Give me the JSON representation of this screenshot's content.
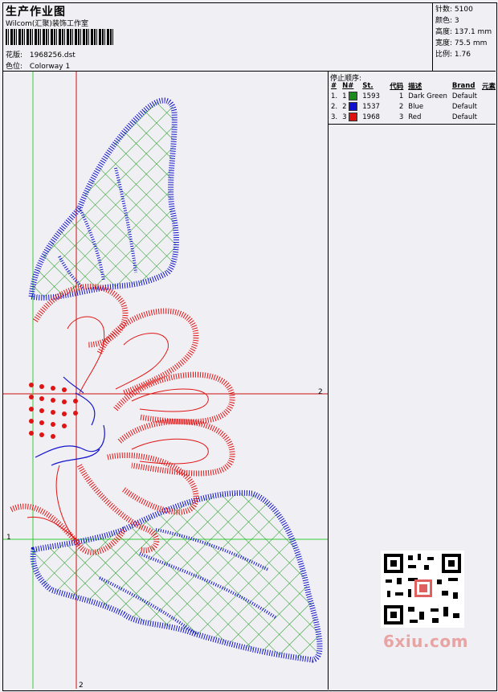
{
  "header": {
    "title": "生产作业图",
    "company": "Wilcom(汇聚)装饰工作室",
    "design_label": "花版:",
    "design_value": "1968256.dst",
    "colorway_label": "色位:",
    "colorway_value": "Colorway 1"
  },
  "stats": [
    {
      "label": "针数:",
      "value": "5100"
    },
    {
      "label": "颜色:",
      "value": "3"
    },
    {
      "label": "高度:",
      "value": "137.1 mm"
    },
    {
      "label": "宽度:",
      "value": "75.5 mm"
    },
    {
      "label": "比例:",
      "value": "1.76"
    }
  ],
  "stop_sequence": {
    "title": "停止顺序:",
    "columns": [
      "#",
      "N#",
      "St.",
      "代码",
      "描述",
      "Brand",
      "元素"
    ],
    "rows": [
      {
        "num": "1.",
        "n": "1",
        "color": "#1a8a1a",
        "st": "1593",
        "code": "1",
        "desc": "Dark Green",
        "brand": "Default",
        "elem": ""
      },
      {
        "num": "2.",
        "n": "2",
        "color": "#1010d0",
        "st": "1537",
        "code": "2",
        "desc": "Blue",
        "brand": "Default",
        "elem": ""
      },
      {
        "num": "3.",
        "n": "3",
        "color": "#e01010",
        "st": "1968",
        "code": "3",
        "desc": "Red",
        "brand": "Default",
        "elem": ""
      }
    ]
  },
  "guides": {
    "h1_label": "2",
    "v1_label": "1",
    "h2_label": "1",
    "v2_label": "2"
  },
  "watermark": "6xiu.com",
  "colors": {
    "green": "#1a9a1a",
    "blue": "#1414cc",
    "red": "#e01414",
    "guide_green": "#33cc33",
    "guide_red": "#cc1111"
  }
}
